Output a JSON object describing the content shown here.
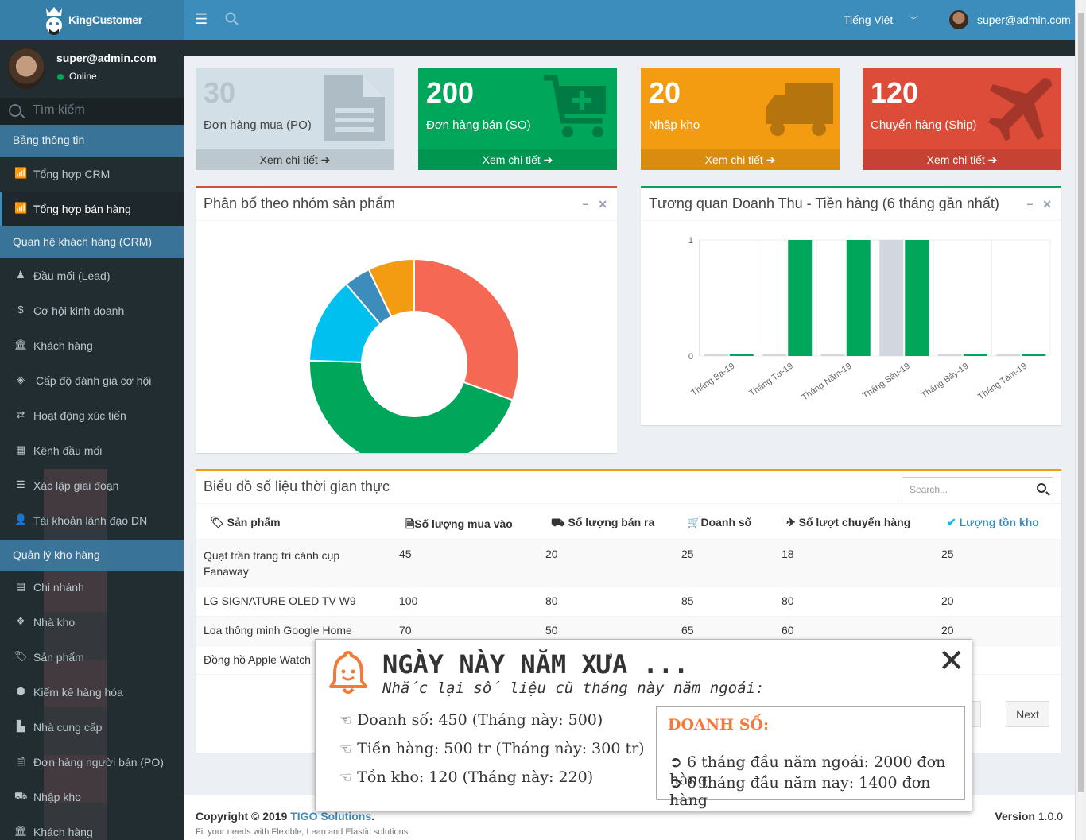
{
  "app": {
    "name": "KingCustomer",
    "language": "Tiếng Việt",
    "user": "super@admin.com",
    "status": "Online",
    "search_placeholder": "Tìm kiếm"
  },
  "sidebar": {
    "sections": [
      {
        "title": "Bảng thông tin",
        "items": [
          {
            "label": "Tổng hợp CRM",
            "icon": "bar-chart-icon"
          },
          {
            "label": "Tổng hợp bán hàng",
            "icon": "bar-chart-icon",
            "active": true
          }
        ]
      },
      {
        "title": "Quan hệ khách hàng (CRM)",
        "items": [
          {
            "label": "Đầu mối (Lead)",
            "icon": "chess-pawn-icon"
          },
          {
            "label": "Cơ hội kinh doanh",
            "icon": "dollar-icon"
          },
          {
            "label": "Khách hàng",
            "icon": "bank-icon"
          },
          {
            "label": "Cấp độ đánh giá cơ hội",
            "icon": "cubes-icon"
          },
          {
            "label": "Hoạt động xúc tiến",
            "icon": "exchange-icon"
          },
          {
            "label": "Kênh đầu mối",
            "icon": "grid-icon"
          },
          {
            "label": "Xác lập giai đoạn",
            "icon": "list-icon"
          },
          {
            "label": "Tài khoản lãnh đạo DN",
            "icon": "user-icon"
          }
        ]
      },
      {
        "title": "Quản lý kho hàng",
        "items": [
          {
            "label": "Chi nhánh",
            "icon": "building-icon"
          },
          {
            "label": "Nhà kho",
            "icon": "cubes-icon"
          },
          {
            "label": "Sản phẩm",
            "icon": "tags-icon"
          },
          {
            "label": "Kiểm kê hàng hóa",
            "icon": "cube-icon"
          },
          {
            "label": "Nhà cung cấp",
            "icon": "industry-icon"
          },
          {
            "label": "Đơn hàng người bán (PO)",
            "icon": "file-icon"
          },
          {
            "label": "Nhập kho",
            "icon": "truck-icon"
          },
          {
            "label": "Khách hàng",
            "icon": "bank-icon"
          }
        ]
      }
    ]
  },
  "info_boxes": [
    {
      "value": "30",
      "label": "Đơn hàng mua (PO)",
      "link": "Xem chi tiết",
      "color": "#d2dfe6",
      "icon": "file-icon"
    },
    {
      "value": "200",
      "label": "Đơn hàng bán (SO)",
      "link": "Xem chi tiết",
      "color": "#00a65a",
      "icon": "cart-icon"
    },
    {
      "value": "20",
      "label": "Nhập kho",
      "link": "Xem chi tiết",
      "color": "#f39c12",
      "icon": "truck-icon"
    },
    {
      "value": "120",
      "label": "Chuyển hàng (Ship)",
      "link": "Xem chi tiết",
      "color": "#dd4b39",
      "icon": "plane-icon"
    }
  ],
  "donut_panel": {
    "title": "Phân bố theo nhóm sản phẩm"
  },
  "bar_panel": {
    "title": "Tương quan Doanh Thu - Tiền hàng (6 tháng gần nhất)"
  },
  "chart_data": [
    {
      "type": "pie",
      "donut": true,
      "slices": [
        {
          "value": 30,
          "color": "#f56954"
        },
        {
          "value": 44,
          "color": "#00a65a"
        },
        {
          "value": 13,
          "color": "#00c0ef"
        },
        {
          "value": 4,
          "color": "#3c8dbc"
        },
        {
          "value": 7,
          "color": "#f39c12"
        }
      ]
    },
    {
      "type": "bar",
      "categories": [
        "Tháng Ba-19",
        "Tháng Tư-19",
        "Tháng Năm-19",
        "Tháng Sáu-19",
        "Tháng Bảy-19",
        "Tháng Tám-19"
      ],
      "ylim": [
        0,
        1
      ],
      "yticks": [
        "0",
        "1"
      ],
      "series": [
        {
          "color": "#d2d6de",
          "values": [
            0,
            0,
            0,
            1,
            0,
            0
          ]
        },
        {
          "color": "#00a65a",
          "values": [
            0,
            1,
            1,
            1,
            0,
            0
          ]
        }
      ]
    }
  ],
  "table_panel": {
    "title": "Biểu đồ số liệu thời gian thực",
    "search_placeholder": "Search...",
    "next": "Next",
    "headers": [
      {
        "label": "Sản phẩm",
        "icon": "tags-icon"
      },
      {
        "label": "Số lượng mua vào",
        "icon": "file-icon"
      },
      {
        "label": "Số lượng bán ra",
        "icon": "truck-icon"
      },
      {
        "label": "Doanh số",
        "icon": "cart-icon"
      },
      {
        "label": "Số lượt chuyển hàng",
        "icon": "plane-icon"
      },
      {
        "label": "Lượng tồn kho",
        "icon": "check-circle-icon"
      }
    ],
    "rows": [
      [
        "Quạt trần trang trí cánh cụp Fanaway",
        "45",
        "20",
        "25",
        "18",
        "25"
      ],
      [
        "LG SIGNATURE OLED TV W9",
        "100",
        "80",
        "85",
        "80",
        "20"
      ],
      [
        "Loa thông minh Google Home",
        "70",
        "50",
        "65",
        "60",
        "20"
      ],
      [
        "Đồng hồ Apple Watch",
        "",
        "",
        "",
        "",
        ""
      ]
    ]
  },
  "footer": {
    "copyright": "Copyright © 2019 ",
    "company": "TIGO Solutions",
    "tagline": "Fit your needs with Flexible, Lean and Elastic solutions.",
    "version_label": "Version",
    "version": "1.0.0"
  },
  "popup": {
    "title": "NGÀY NÀY NĂM XƯA ...",
    "subtitle": "Nhắc lại số liệu cũ tháng này năm ngoái:",
    "lines": [
      "Doanh số: 450 (Tháng này: 500)",
      "Tiền hàng: 500 tr (Tháng này: 300 tr)",
      "Tồn kho: 120 (Tháng này: 220)"
    ],
    "box_title": "DOANH SỐ:",
    "box_lines": [
      "6 tháng đầu năm ngoái: 2000 đơn hàng",
      "6 tháng đầu năm nay: 1400 đơn hàng"
    ],
    "close": "✕"
  }
}
